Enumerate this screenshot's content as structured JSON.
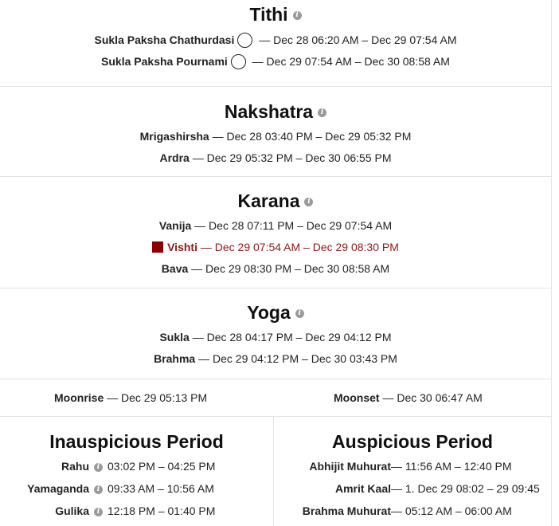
{
  "tithi": {
    "title": "Tithi",
    "rows": [
      {
        "name": "Sukla Paksha Chathurdasi",
        "range": " — Dec 28 06:20 AM – Dec 29 07:54 AM"
      },
      {
        "name": "Sukla Paksha Pournami",
        "range": " — Dec 29 07:54 AM – Dec 30 08:58 AM"
      }
    ]
  },
  "nakshatra": {
    "title": "Nakshatra",
    "rows": [
      {
        "name": "Mrigashirsha",
        "range": " — Dec 28 03:40 PM – Dec 29 05:32 PM"
      },
      {
        "name": "Ardra",
        "range": " — Dec 29 05:32 PM – Dec 30 06:55 PM"
      }
    ]
  },
  "karana": {
    "title": "Karana",
    "rows": [
      {
        "name": "Vanija",
        "range": " — Dec 28 07:11 PM – Dec 29 07:54 AM"
      },
      {
        "name": "Vishti",
        "range": " — Dec 29 07:54 AM – Dec 29 08:30 PM"
      },
      {
        "name": "Bava",
        "range": " — Dec 29 08:30 PM – Dec 30 08:58 AM"
      }
    ]
  },
  "yoga": {
    "title": "Yoga",
    "rows": [
      {
        "name": "Sukla",
        "range": " — Dec 28 04:17 PM – Dec 29 04:12 PM"
      },
      {
        "name": "Brahma",
        "range": " — Dec 29 04:12 PM – Dec 30 03:43 PM"
      }
    ]
  },
  "moon": {
    "rise_label": "Moonrise",
    "rise_value": " — Dec 29 05:13 PM",
    "set_label": "Moonset",
    "set_value": " — Dec 30 06:47 AM"
  },
  "inauspicious": {
    "title": "Inauspicious Period",
    "rows": [
      {
        "name": "Rahu",
        "value": "03:02 PM – 04:25 PM"
      },
      {
        "name": "Yamaganda",
        "value": "09:33 AM – 10:56 AM"
      },
      {
        "name": "Gulika",
        "value": "12:18 PM – 01:40 PM"
      }
    ]
  },
  "auspicious": {
    "title": "Auspicious Period",
    "rows": [
      {
        "name": "Abhijit Muhurat",
        "value": " — 11:56 AM – 12:40 PM"
      },
      {
        "name": "Amrit Kaal",
        "value": " — 1. Dec 29 08:02 – 29 09:45"
      },
      {
        "name": "Brahma Muhurat",
        "value": " — 05:12 AM – 06:00 AM"
      }
    ]
  },
  "colors": {
    "vishti": "#8b0000",
    "text": "#222222"
  }
}
